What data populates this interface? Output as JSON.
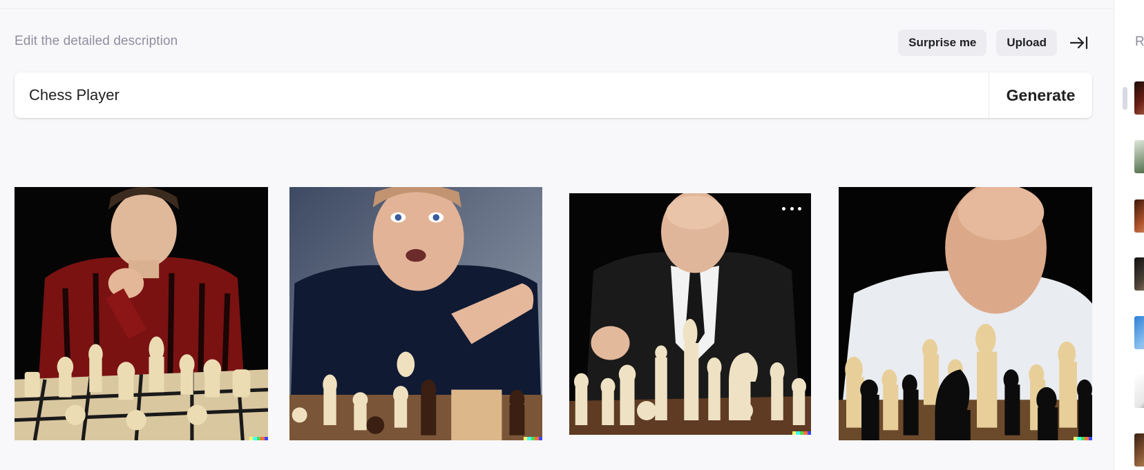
{
  "editor": {
    "description_label": "Edit the detailed description",
    "prompt_value": "Chess Player",
    "generate_label": "Generate"
  },
  "actions": {
    "surprise_label": "Surprise me",
    "upload_label": "Upload",
    "collapse_icon": "arrow-to-right-icon"
  },
  "results": {
    "image_count": 4,
    "signature_colors": [
      "#ffff66",
      "#42ffff",
      "#51da4c",
      "#ff6e3c",
      "#3c46ff"
    ]
  },
  "history": {
    "label_partial": "R",
    "thumbnail_count": 7
  },
  "colors": {
    "background": "#f8f8fa",
    "button_bg": "#ececf1",
    "muted_text": "#8e8ea0"
  }
}
